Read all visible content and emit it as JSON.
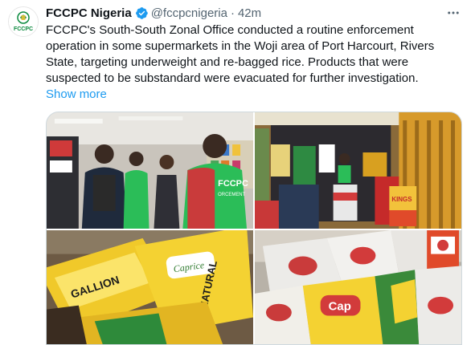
{
  "author": {
    "name": "FCCPC Nigeria",
    "handle": "@fccpcnigeria",
    "separator": "·",
    "time": "42m",
    "avatar_text": "FCCPC"
  },
  "tweet": {
    "text": "FCCPC's South-South Zonal Office conducted a routine enforcement operation in some supermarkets in the Woji area of Port Harcourt, Rivers State, targeting underweight and re-bagged rice. Products that were suspected to be substandard were evacuated for further investigation.",
    "show_more": "Show more"
  },
  "media": {
    "photos": [
      {
        "label": "officers-in-supermarket-photo",
        "vest_text": "FCCPC",
        "vest_sub": "ORCEMENT"
      },
      {
        "label": "shop-front-goods-photo",
        "carton_text": "KINGS"
      },
      {
        "label": "rice-bags-closeup-photo",
        "bag_text": "GALLION",
        "bag_text2": "NATURAL",
        "bag_brand": "Caprice"
      },
      {
        "label": "evacuated-rice-bags-photo",
        "bag_brand": "Cap"
      }
    ]
  },
  "colors": {
    "accent": "#1d9bf0",
    "verified": "#1d9bf0",
    "secondary_text": "#536471",
    "avatar_green": "#0b8a3e",
    "vest_green": "#2bbd58",
    "rice_yellow": "#f0c92a"
  },
  "icons": {
    "verified": "verified-badge-icon",
    "more": "more-options-icon"
  }
}
